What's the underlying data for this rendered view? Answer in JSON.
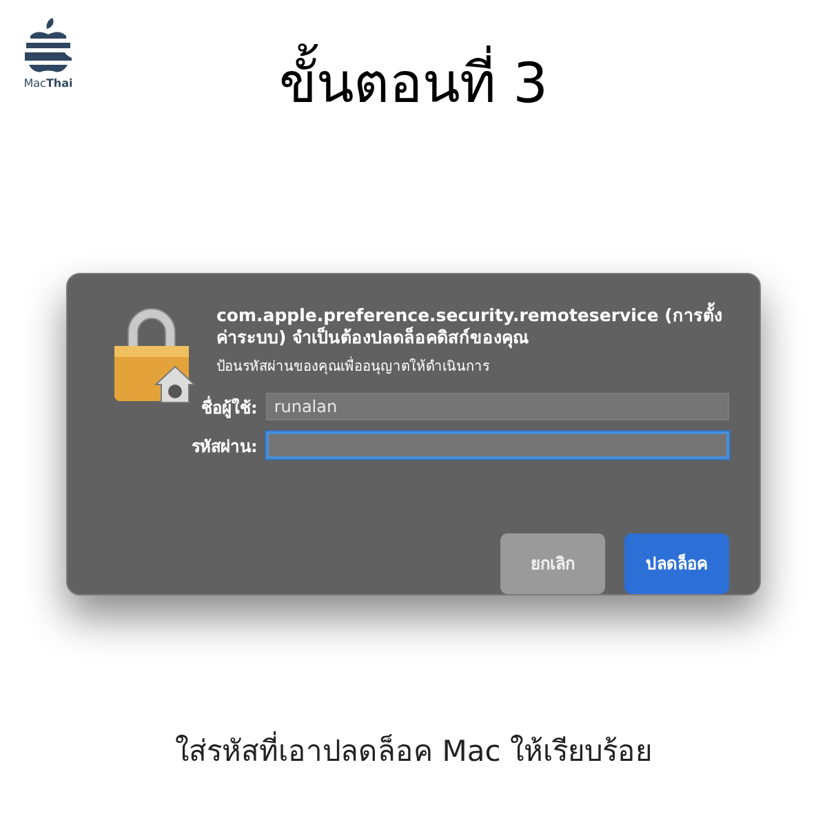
{
  "logo": {
    "text": "Mac**Thai**"
  },
  "heading": "ขั้นตอนที่ 3",
  "dialog": {
    "title": "com.apple.preference.security.remoteservice (การตั้งค่าระบบ) จำเป็นต้องปลดล็อคดิสก์ของคุณ",
    "message": "ป้อนรหัสผ่านของคุณเพื่ออนุญาตให้ดำเนินการ",
    "fields": [
      {
        "label": "ชื่อผู้ใช้:",
        "value": "runalan",
        "focused": false
      },
      {
        "label": "รหัสผ่าน:",
        "focused": true
      }
    ],
    "buttons": [
      {
        "label": "ยกเลิก",
        "kind": "secondary"
      },
      {
        "label": "ปลดล็อค",
        "kind": "default"
      }
    ]
  },
  "caption": "ใส่รหัสที่เอาปลดล็อค Mac ให้เรียบร้อย"
}
